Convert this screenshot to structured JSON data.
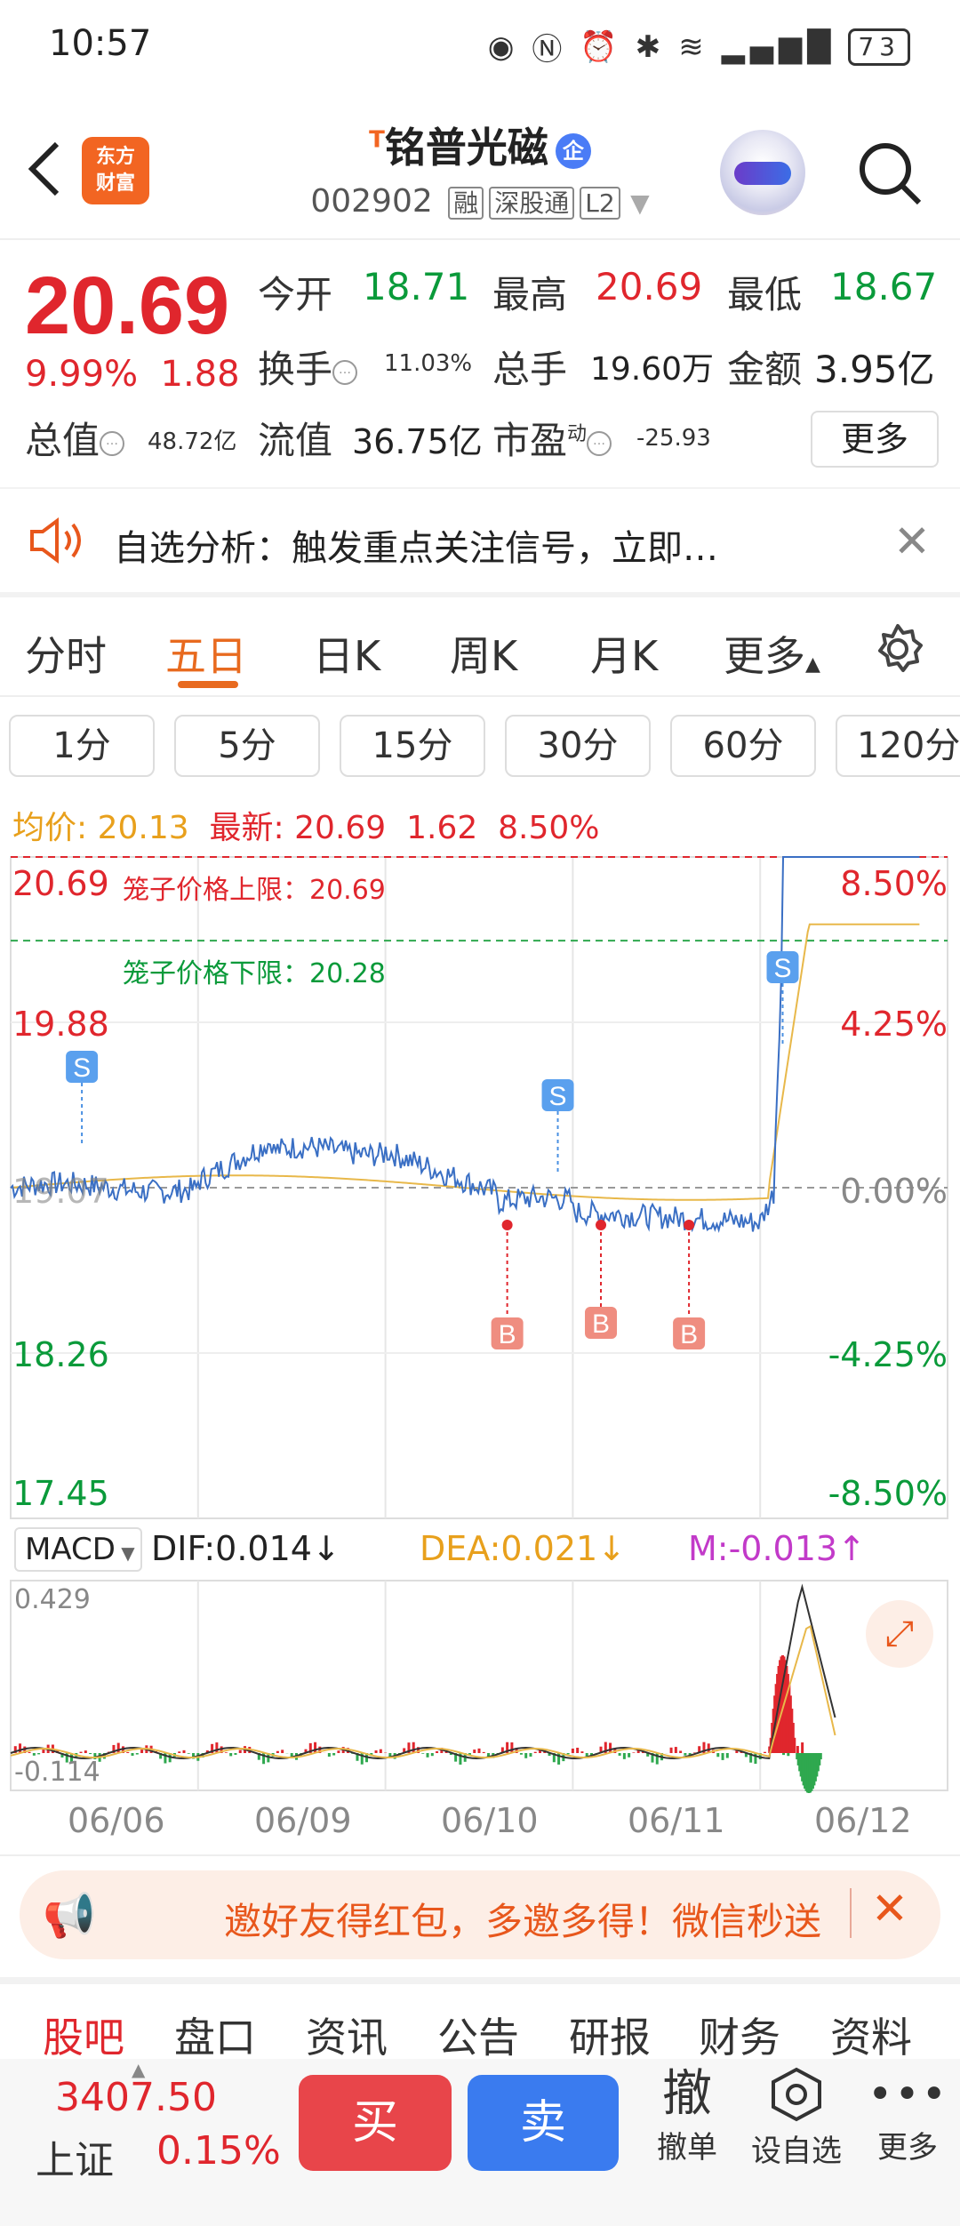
{
  "status_bar": {
    "time": "10:57",
    "battery": "73"
  },
  "header": {
    "t_mark": "T",
    "stock_name": "铭普光磁",
    "qi_badge": "企",
    "code": "002902",
    "tag_rong": "融",
    "tag_sgt": "深股通",
    "tag_l2": "L2"
  },
  "quote": {
    "price": "20.69",
    "change_pct": "9.99%",
    "change_amt": "1.88",
    "open_label": "今开",
    "open": "18.71",
    "high_label": "最高",
    "high": "20.69",
    "low_label": "最低",
    "low": "18.67",
    "turnover_label": "换手",
    "turnover": "11.03%",
    "volume_label": "总手",
    "volume": "19.60万",
    "amount_label": "金额",
    "amount": "3.95亿",
    "mktcap_label": "总值",
    "mktcap": "48.72亿",
    "float_label": "流值",
    "float": "36.75亿",
    "pe_label": "市盈",
    "pe_sup": "动",
    "pe": "-25.93",
    "more": "更多"
  },
  "banner": {
    "text": "自选分析：触发重点关注信号，立即…"
  },
  "tabs": [
    "分时",
    "五日",
    "日K",
    "周K",
    "月K",
    "更多"
  ],
  "active_tab": 1,
  "periods": [
    "1分",
    "5分",
    "15分",
    "30分",
    "60分",
    "120分"
  ],
  "avg_line": {
    "avg_label": "均价:",
    "avg": "20.13",
    "latest_label": "最新:",
    "latest": "20.69",
    "chg": "1.62",
    "pct": "8.50%"
  },
  "chart_data": {
    "type": "line",
    "x_labels": [
      "06/06",
      "06/09",
      "06/10",
      "06/11",
      "06/12"
    ],
    "y_left": [
      "20.69",
      "19.88",
      "19.07",
      "18.26",
      "17.45"
    ],
    "y_right": [
      "8.50%",
      "4.25%",
      "0.00%",
      "-4.25%",
      "-8.50%"
    ],
    "ylim": [
      17.45,
      20.69
    ],
    "base": 19.07,
    "upper_limit_label": "笼子价格上限：20.69",
    "lower_limit_label": "笼子价格下限：20.28",
    "upper_limit": 20.69,
    "lower_limit": 20.28,
    "signals": [
      {
        "type": "S",
        "day": 0.38
      },
      {
        "type": "S",
        "day": 2.92
      },
      {
        "type": "S",
        "day": 4.12
      },
      {
        "type": "B",
        "day": 2.65
      },
      {
        "type": "B",
        "day": 3.15
      },
      {
        "type": "B",
        "day": 3.62
      }
    ],
    "macd": {
      "label": "MACD",
      "dif": "DIF:0.014↓",
      "dea": "DEA:0.021↓",
      "m": "M:-0.013↑",
      "max": "0.429",
      "min": "-0.114"
    }
  },
  "invite": {
    "text": "邀好友得红包，多邀多得！微信秒送"
  },
  "bottom_tabs": [
    "股吧",
    "盘口",
    "资讯",
    "公告",
    "研报",
    "财务",
    "资料"
  ],
  "footer": {
    "index_value": "3407.50",
    "index_name": "上证",
    "index_pct": "0.15%",
    "buy": "买",
    "sell": "卖",
    "cancel_icon": "撤",
    "cancel": "撤单",
    "watch": "设自选",
    "more": "更多"
  },
  "colors": {
    "up": "#e0262d",
    "down": "#0a9a3a",
    "accent": "#e86a1f",
    "price_line": "#3a6fc4",
    "avg_line": "#e8b84a"
  }
}
